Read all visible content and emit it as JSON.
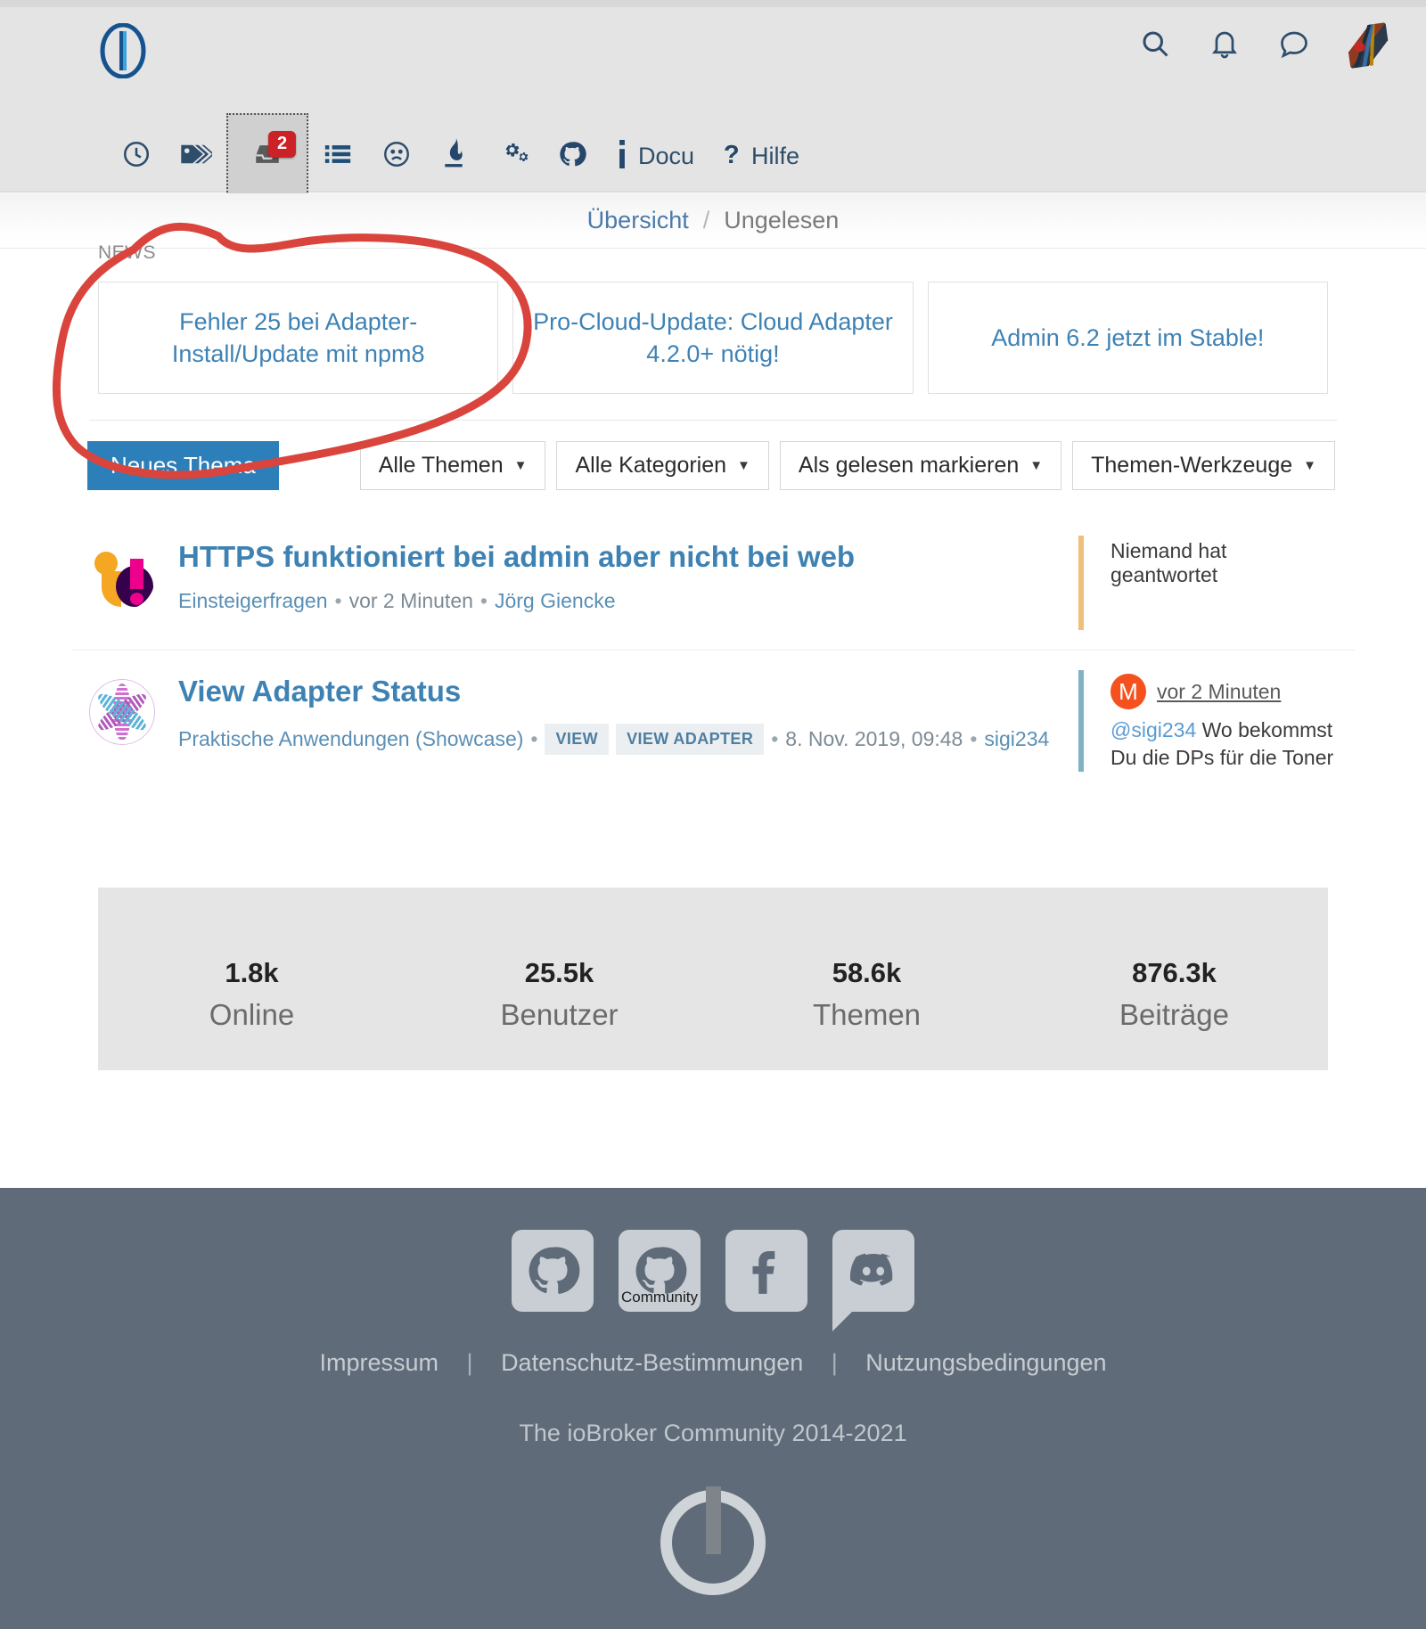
{
  "header": {
    "logo": "iobroker-logo",
    "icons": [
      {
        "name": "search-icon",
        "label": "Suche"
      },
      {
        "name": "bell-icon",
        "label": "Benachrichtigungen"
      },
      {
        "name": "chat-icon",
        "label": "Chat"
      },
      {
        "name": "avatar",
        "label": "Profil"
      }
    ]
  },
  "nav": {
    "items": [
      {
        "name": "recent-icon",
        "label": "",
        "icon": "clock",
        "badge": "",
        "active": false
      },
      {
        "name": "tags-icon",
        "label": "",
        "icon": "tags",
        "badge": "",
        "active": false
      },
      {
        "name": "unread-icon",
        "label": "",
        "icon": "inbox",
        "badge": "2",
        "active": true
      },
      {
        "name": "categories-icon",
        "label": "",
        "icon": "list",
        "badge": "",
        "active": false
      },
      {
        "name": "unsolved-icon",
        "label": "",
        "icon": "frown",
        "badge": "",
        "active": false
      },
      {
        "name": "flame-icon",
        "label": "",
        "icon": "flame",
        "badge": "",
        "active": false
      },
      {
        "name": "gears-icon",
        "label": "",
        "icon": "gears",
        "badge": "",
        "active": false
      },
      {
        "name": "github-icon",
        "label": "",
        "icon": "github",
        "badge": "",
        "active": false
      },
      {
        "name": "docu-link",
        "label": "Docu",
        "icon": "info",
        "badge": "",
        "active": false
      },
      {
        "name": "hilfe-link",
        "label": "Hilfe",
        "icon": "question",
        "badge": "",
        "active": false
      }
    ]
  },
  "breadcrumb": {
    "root": "Übersicht",
    "separator": "/",
    "current": "Ungelesen"
  },
  "news": {
    "section_label": "NEWS",
    "cards": [
      {
        "title": "Fehler 25 bei Adapter-Install/Update mit npm8"
      },
      {
        "title": "Pro-Cloud-Update: Cloud Adapter 4.2.0+ nötig!"
      },
      {
        "title": "Admin 6.2 jetzt im Stable!"
      }
    ]
  },
  "toolbar": {
    "new_topic": "Neues Thema",
    "filters": [
      {
        "label": "Alle Themen"
      },
      {
        "label": "Alle Kategorien"
      },
      {
        "label": "Als gelesen markieren"
      },
      {
        "label": "Themen-Werkzeuge"
      }
    ]
  },
  "topics": [
    {
      "avatar": "joomla-logo-avatar",
      "title": "HTTPS funktioniert bei admin aber nicht bei web",
      "category": "Einsteigerfragen",
      "time": "vor 2 Minuten",
      "author": "Jörg Giencke",
      "tags": [],
      "date": "",
      "side": {
        "type": "no-reply",
        "text": "Niemand hat geantwortet",
        "accent": "#f0c078"
      }
    },
    {
      "avatar": "view-adapter-avatar",
      "title": "View Adapter Status",
      "category": "Praktische Anwendungen (Showcase)",
      "time": "",
      "author": "sigi234",
      "tags": [
        "VIEW",
        "VIEW ADAPTER"
      ],
      "date": "8. Nov. 2019, 09:48",
      "side": {
        "type": "reply",
        "avatar_initial": "M",
        "avatar_color": "#f4511e",
        "time": "vor 2 Minuten",
        "mention": "@sigi234",
        "text": " Wo bekommst Du die DPs für die Toner im Brother Drucker her?",
        "accent": "#7fb2c4"
      }
    }
  ],
  "stats": [
    {
      "value": "1.8k",
      "label": "Online"
    },
    {
      "value": "25.5k",
      "label": "Benutzer"
    },
    {
      "value": "58.6k",
      "label": "Themen"
    },
    {
      "value": "876.3k",
      "label": "Beiträge"
    }
  ],
  "footer": {
    "social": [
      {
        "name": "github-icon",
        "caption": ""
      },
      {
        "name": "github-community-icon",
        "caption": "Community"
      },
      {
        "name": "facebook-icon",
        "caption": ""
      },
      {
        "name": "discord-icon",
        "caption": ""
      }
    ],
    "links": [
      {
        "label": "Impressum"
      },
      {
        "label": "Datenschutz-Bestimmungen"
      },
      {
        "label": "Nutzungsbedingungen"
      }
    ],
    "separator": "|",
    "copyright": "The ioBroker Community 2014-2021",
    "logo": "iobroker-power-logo"
  },
  "annotation": {
    "type": "hand-drawn-ellipse",
    "color": "#d9453d",
    "target": "news card 1"
  }
}
